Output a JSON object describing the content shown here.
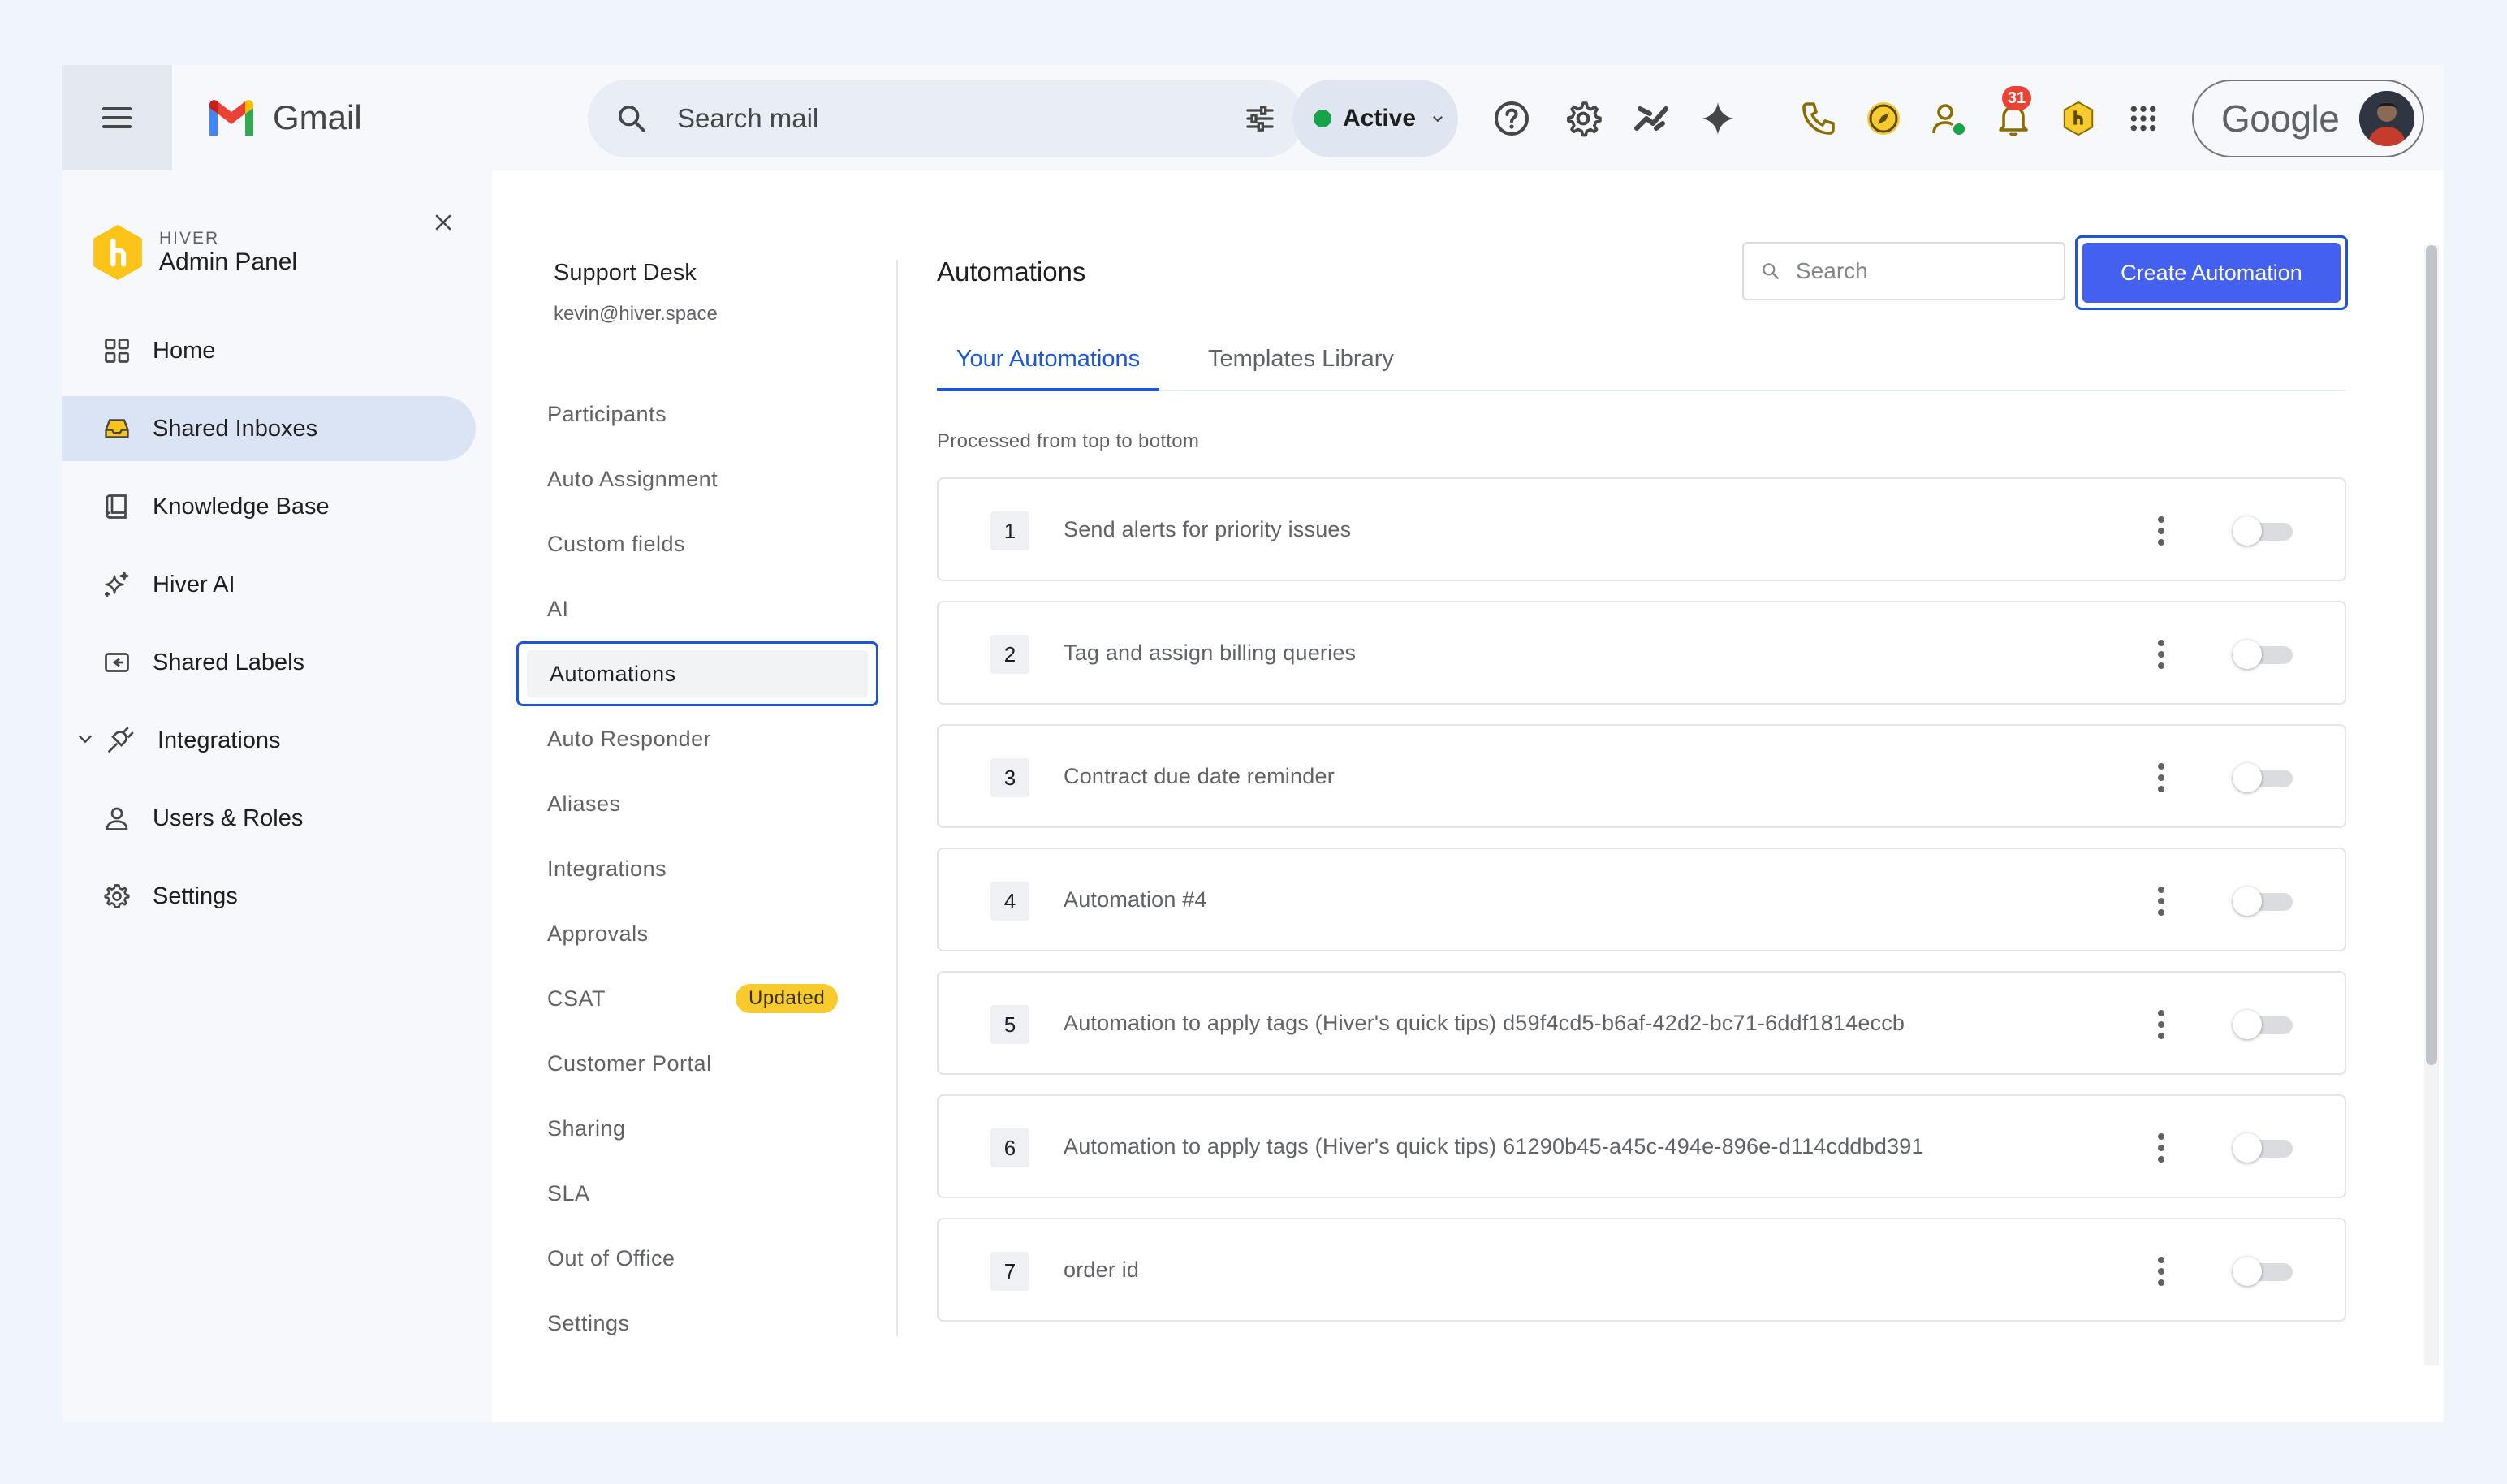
{
  "gmail": {
    "app_name": "Gmail",
    "search_placeholder": "Search mail",
    "status": "Active",
    "notification_count": "31",
    "account_label": "Google",
    "colors": {
      "status_dot": "#18a34b",
      "badge": "#ea4335"
    }
  },
  "hiver": {
    "brand": "HIVER",
    "panel_title": "Admin Panel",
    "nav": [
      {
        "label": "Home",
        "icon": "grid-icon"
      },
      {
        "label": "Shared Inboxes",
        "icon": "inbox-icon",
        "active": true
      },
      {
        "label": "Knowledge Base",
        "icon": "book-icon"
      },
      {
        "label": "Hiver AI",
        "icon": "sparkle-icon"
      },
      {
        "label": "Shared Labels",
        "icon": "label-icon"
      },
      {
        "label": "Integrations",
        "icon": "plug-icon",
        "expandable": true
      },
      {
        "label": "Users & Roles",
        "icon": "user-icon"
      },
      {
        "label": "Settings",
        "icon": "gear-icon"
      }
    ]
  },
  "inbox": {
    "name": "Support Desk",
    "email": "kevin@hiver.space",
    "menu": [
      {
        "label": "Participants"
      },
      {
        "label": "Auto Assignment"
      },
      {
        "label": "Custom fields"
      },
      {
        "label": "AI"
      },
      {
        "label": "Automations",
        "active": true
      },
      {
        "label": "Auto Responder"
      },
      {
        "label": "Aliases"
      },
      {
        "label": "Integrations"
      },
      {
        "label": "Approvals"
      },
      {
        "label": "CSAT",
        "badge": "Updated"
      },
      {
        "label": "Customer Portal"
      },
      {
        "label": "Sharing"
      },
      {
        "label": "SLA"
      },
      {
        "label": "Out of Office"
      },
      {
        "label": "Settings"
      }
    ]
  },
  "automations": {
    "title": "Automations",
    "search_placeholder": "Search",
    "create_label": "Create Automation",
    "tabs": [
      {
        "label": "Your Automations",
        "active": true
      },
      {
        "label": "Templates Library"
      }
    ],
    "processed_note": "Processed from top to bottom",
    "items": [
      {
        "index": "1",
        "name": "Send alerts for priority issues",
        "enabled": false
      },
      {
        "index": "2",
        "name": "Tag and assign billing queries",
        "enabled": false
      },
      {
        "index": "3",
        "name": "Contract due date reminder",
        "enabled": false
      },
      {
        "index": "4",
        "name": "Automation #4",
        "enabled": false
      },
      {
        "index": "5",
        "name": "Automation to apply tags (Hiver's quick tips) d59f4cd5-b6af-42d2-bc71-6ddf1814eccb",
        "enabled": false
      },
      {
        "index": "6",
        "name": "Automation to apply tags (Hiver's quick tips) 61290b45-a45c-494e-896e-d114cddbd391",
        "enabled": false
      },
      {
        "index": "7",
        "name": "order id",
        "enabled": false
      }
    ],
    "colors": {
      "primary": "#4361ee",
      "accent": "#1a56db",
      "badge": "#f7cb2d"
    }
  }
}
